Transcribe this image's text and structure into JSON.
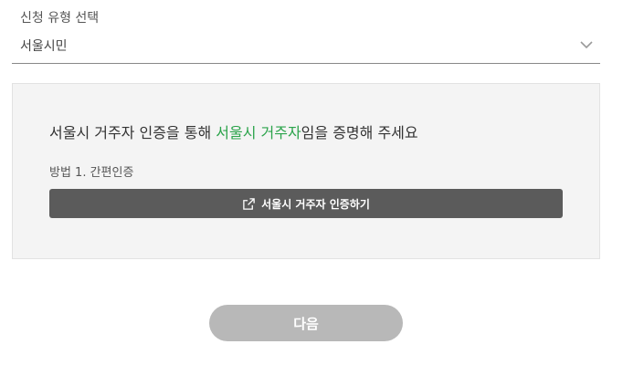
{
  "select": {
    "label": "신청 유형 선택",
    "value": "서울시민"
  },
  "card": {
    "headline_prefix": "서울시 거주자 인증을 통해 ",
    "headline_highlight": "서울시 거주자",
    "headline_suffix": "임을 증명해 주세요",
    "method_label": "방법 1. 간편인증",
    "auth_button_label": "서울시 거주자 인증하기"
  },
  "next_button_label": "다음",
  "colors": {
    "highlight": "#2aa34a",
    "auth_button_bg": "#5b5b5b",
    "next_button_bg": "#b8b8b8",
    "card_bg": "#f4f4f4"
  },
  "icons": {
    "select_chevron": "chevron-down-icon",
    "auth_button": "external-link-icon"
  }
}
